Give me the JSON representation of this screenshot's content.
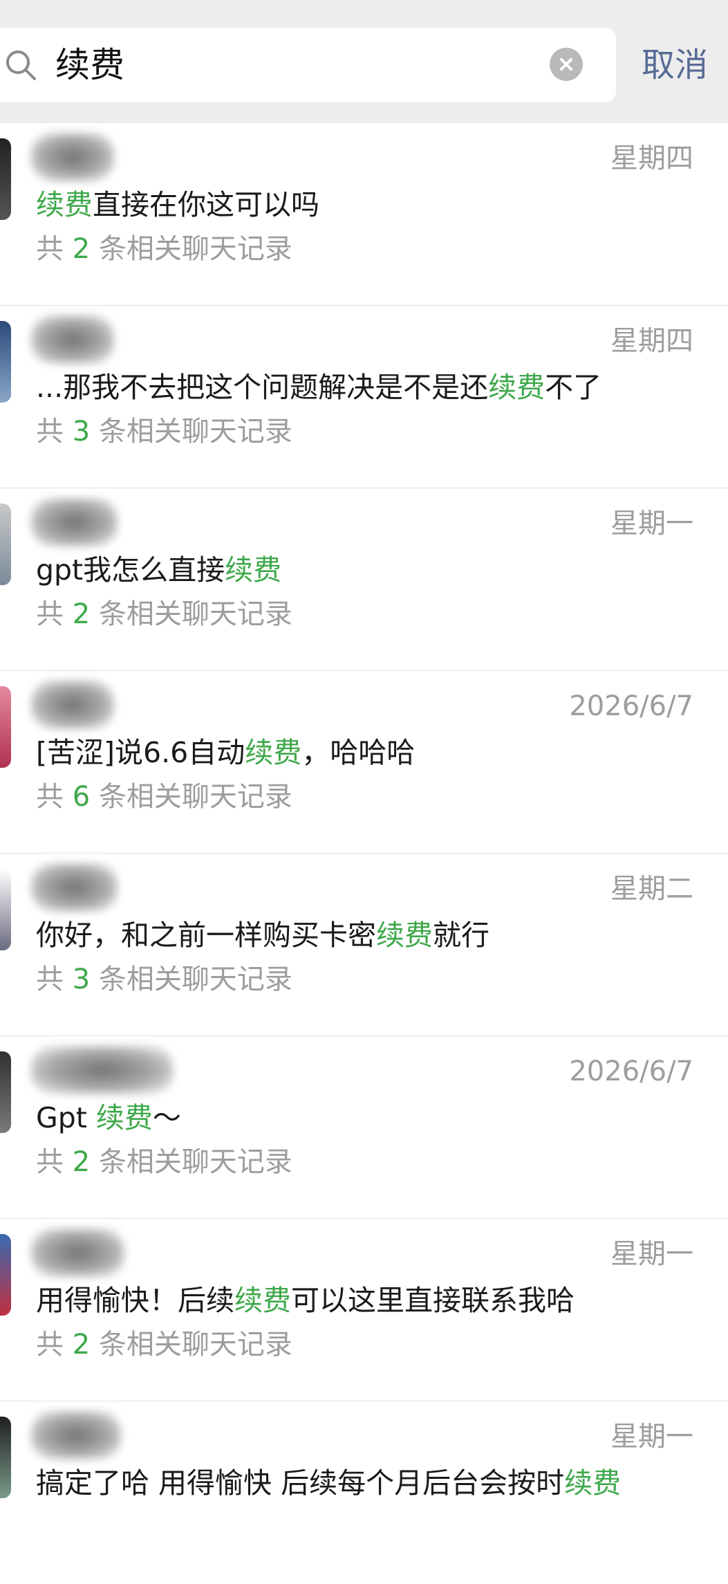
{
  "search": {
    "query": "续费",
    "cancel_label": "取消"
  },
  "results": [
    {
      "date": "星期四",
      "message": {
        "pre": "",
        "hl": "续费",
        "post": "直接在你这可以吗"
      },
      "count": {
        "prefix": "共",
        "num": "2",
        "suffix": "条相关聊天记录"
      }
    },
    {
      "date": "星期四",
      "message": {
        "pre": "...那我不去把这个问题解决是不是还",
        "hl": "续费",
        "post": "不了"
      },
      "count": {
        "prefix": "共",
        "num": "3",
        "suffix": "条相关聊天记录"
      }
    },
    {
      "date": "星期一",
      "message": {
        "pre": "gpt我怎么直接",
        "hl": "续费",
        "post": ""
      },
      "count": {
        "prefix": "共",
        "num": "2",
        "suffix": "条相关聊天记录"
      }
    },
    {
      "date": "2026/6/7",
      "message": {
        "pre": "[苦涩]说6.6自动",
        "hl": "续费",
        "post": "，哈哈哈"
      },
      "count": {
        "prefix": "共",
        "num": "6",
        "suffix": "条相关聊天记录"
      }
    },
    {
      "date": "星期二",
      "message": {
        "pre": "你好，和之前一样购买卡密",
        "hl": "续费",
        "post": "就行"
      },
      "count": {
        "prefix": "共",
        "num": "3",
        "suffix": "条相关聊天记录"
      }
    },
    {
      "date": "2026/6/7",
      "message": {
        "pre": "Gpt ",
        "hl": "续费",
        "post": "～"
      },
      "count": {
        "prefix": "共",
        "num": "2",
        "suffix": "条相关聊天记录"
      }
    },
    {
      "date": "星期一",
      "message": {
        "pre": "用得愉快！后续",
        "hl": "续费",
        "post": "可以这里直接联系我哈"
      },
      "count": {
        "prefix": "共",
        "num": "2",
        "suffix": "条相关聊天记录"
      }
    },
    {
      "date": "星期一",
      "message": {
        "pre": "搞定了哈 用得愉快 后续每个月后台会按时",
        "hl": "续费",
        "post": ""
      },
      "count": null
    }
  ],
  "colors": {
    "highlight": "#3ea84a",
    "cancel": "#576b95",
    "muted": "#9d9d9d"
  }
}
